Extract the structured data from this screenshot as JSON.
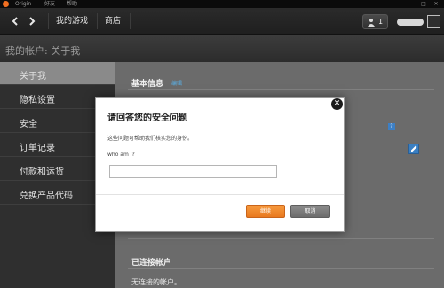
{
  "menubar": {
    "items": [
      "Origin",
      "好友",
      "帮助"
    ],
    "window_controls": [
      "–",
      "□",
      "✕"
    ]
  },
  "nav": {
    "back_icon": "chevron-left-icon",
    "forward_icon": "chevron-right-icon",
    "links": [
      "我的游戏",
      "商店"
    ],
    "friends_count": "1"
  },
  "page": {
    "title": "我的帐户: 关于我"
  },
  "sidebar": {
    "items": [
      {
        "label": "关于我",
        "active": true
      },
      {
        "label": "隐私设置",
        "active": false
      },
      {
        "label": "安全",
        "active": false
      },
      {
        "label": "订单记录",
        "active": false
      },
      {
        "label": "付款和运货",
        "active": false
      },
      {
        "label": "兑换产品代码",
        "active": false
      }
    ]
  },
  "main": {
    "basic_info_heading": "基本信息",
    "edit_link": "编辑",
    "help_icon": "?",
    "connected_heading": "已连接帐户",
    "no_connected_text": "无连接的帐户。"
  },
  "modal": {
    "title": "请回答您的安全问题",
    "description": "这些问题可帮助我们核实您的身份。",
    "question": "who am I?",
    "answer_value": "",
    "confirm_label": "继续",
    "cancel_label": "取消"
  },
  "colors": {
    "brand_orange": "#f26f21",
    "confirm_orange": "#f08a2e",
    "link_blue": "#5ab0e6",
    "active_sidebar": "#8a8a8a"
  }
}
